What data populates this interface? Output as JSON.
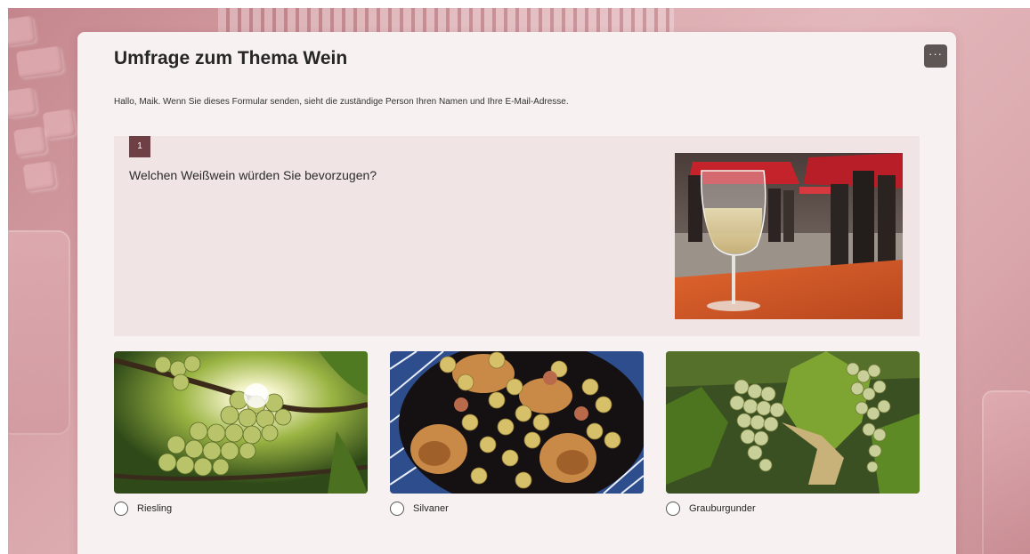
{
  "form": {
    "title": "Umfrage zum Thema Wein",
    "intro": "Hallo, Maik. Wenn Sie dieses Formular senden, sieht die zuständige Person Ihren Namen und Ihre E-Mail-Adresse.",
    "more_label": "···"
  },
  "question": {
    "number": "1",
    "text": "Welchen Weißwein würden Sie bevorzugen?",
    "image_icon": "wine-glass-market-photo"
  },
  "options": [
    {
      "label": "Riesling",
      "image_icon": "grapes-sunlight-photo"
    },
    {
      "label": "Silvaner",
      "image_icon": "roast-chicken-grapes-photo"
    },
    {
      "label": "Grauburgunder",
      "image_icon": "grapes-vine-photo"
    }
  ],
  "colors": {
    "accent": "#6e3f45",
    "question_bg": "#f0e4e5",
    "card_bg": "#f7f1f1"
  }
}
